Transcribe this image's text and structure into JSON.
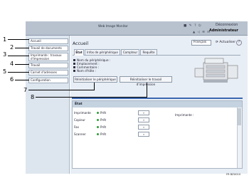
{
  "app": {
    "title": "Web Image Monitor",
    "disconnect": "Déconnexion",
    "admin": "Administrateur",
    "toolbar_icons": "■ ✎ ? ⏻",
    "toolbar_icons2": "▲ ◁ ☰ ⊟"
  },
  "sidebar": {
    "items": [
      {
        "label": "Accueil"
      },
      {
        "label": "Travail de documents"
      },
      {
        "label": "Imprimante : travaux d'impression"
      },
      {
        "label": "Travail"
      },
      {
        "label": "Carnet d'adresses"
      },
      {
        "label": "Configuration"
      }
    ]
  },
  "main": {
    "title": "Accueil",
    "language": "Français",
    "refresh": "Actualiser",
    "help": "?",
    "tabs": [
      {
        "label": "État"
      },
      {
        "label": "Infos de périphérique"
      },
      {
        "label": "Compteur"
      },
      {
        "label": "Requête"
      }
    ],
    "info": [
      {
        "label": "Nom du périphérique :"
      },
      {
        "label": "Emplacement :"
      },
      {
        "label": "Commentaire :"
      },
      {
        "label": "Nom d'hôte :"
      }
    ],
    "reset_device": "Réinitialiser le périphérique",
    "reset_print_job": "Réinitialiser le travail d'impression"
  },
  "status": {
    "title": "État",
    "rows": [
      {
        "label": "Imprimante",
        "state": "Prêt"
      },
      {
        "label": "Copieur",
        "state": "Prêt"
      },
      {
        "label": "Fax",
        "state": "Prêt"
      },
      {
        "label": "Scanner",
        "state": "Prêt"
      }
    ],
    "printer_right_label": "Imprimante :"
  },
  "callouts": [
    "1",
    "2",
    "3",
    "4",
    "5",
    "6",
    "7",
    "8"
  ],
  "figure_code": "FR BZU010"
}
